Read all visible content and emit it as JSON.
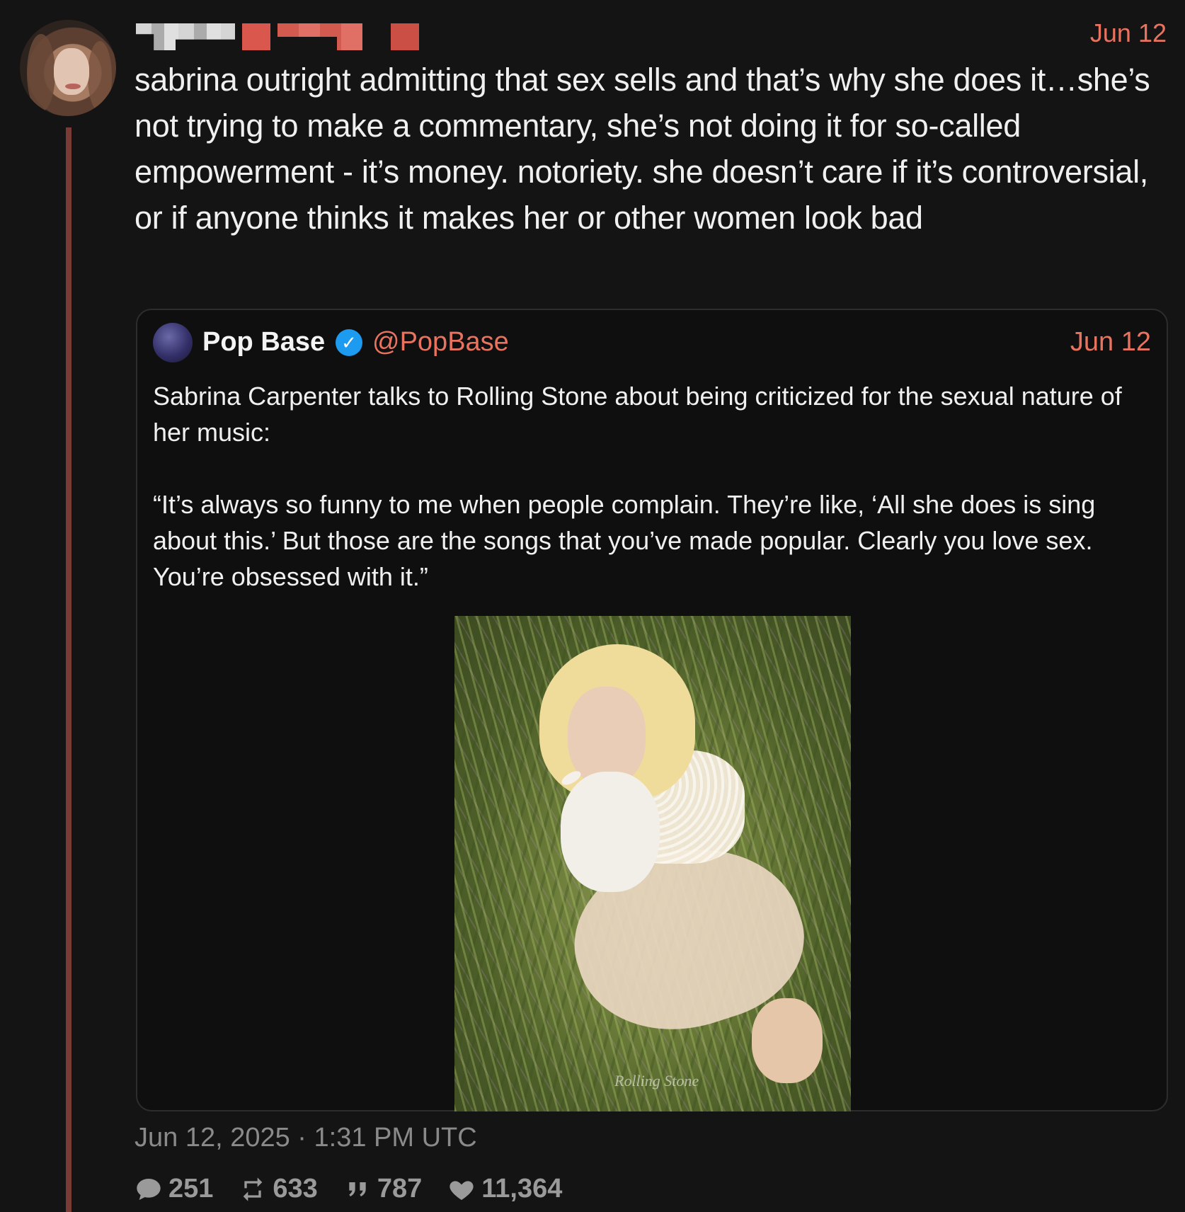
{
  "tweet": {
    "date": "Jun 12",
    "text": "sabrina outright admitting that sex sells and that’s why she does it…she’s not trying to make a commentary, she’s not doing it for so-called empowerment - it’s money. notoriety. she doesn’t care if it’s controversial, or if anyone thinks it makes her or other women look bad"
  },
  "quote": {
    "name": "Pop Base",
    "handle": "@PopBase",
    "date": "Jun 12",
    "text": "Sabrina Carpenter talks to Rolling Stone about being criticized for the sexual nature of her music:\n\n“It’s always so funny to me when people complain. They’re like, ‘All she does is sing about this.’ But those are the songs that you’ve made popular. Clearly you love sex. You’re obsessed with it.”",
    "image_watermark": "Rolling Stone"
  },
  "footer": {
    "timestamp": "Jun 12, 2025 · 1:31 PM UTC",
    "replies": "251",
    "retweets": "633",
    "quotes": "787",
    "likes": "11,364"
  },
  "colors": {
    "accent": "#e8735f",
    "background": "#141414",
    "verified": "#1d9bf0",
    "thread_line": "#7a3a36"
  },
  "icons": [
    "verified-badge-icon",
    "comment-icon",
    "retweet-icon",
    "quote-icon",
    "heart-icon"
  ]
}
